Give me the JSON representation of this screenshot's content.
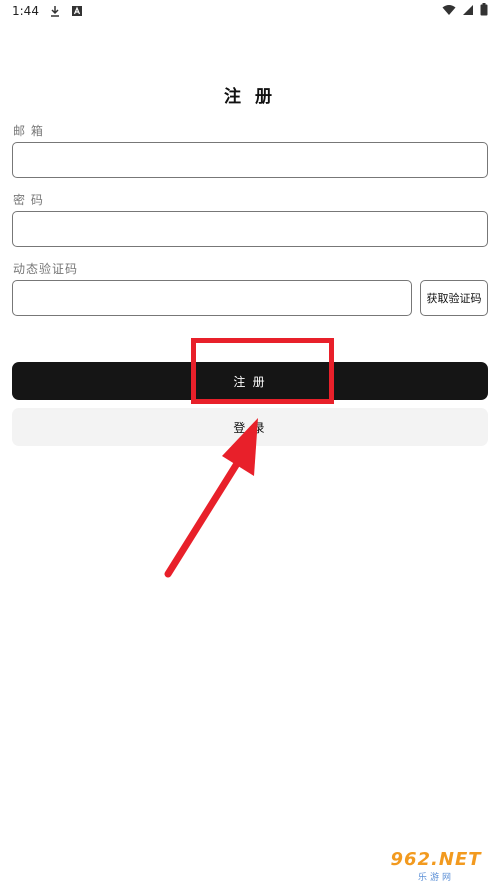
{
  "status_bar": {
    "time": "1:44",
    "icons": [
      "download-icon",
      "a-box-icon",
      "wifi-icon",
      "signal-icon",
      "battery-icon"
    ]
  },
  "form": {
    "title": "注 册",
    "email_label": "邮 箱",
    "email_value": "",
    "password_label": "密 码",
    "password_value": "",
    "code_label": "动态验证码",
    "code_value": "",
    "get_code_label": "获取验证码"
  },
  "actions": {
    "register_label": "注 册",
    "login_label": "登 录"
  },
  "annotation": {
    "color": "#e8202a"
  },
  "watermark": {
    "top": "962.NET",
    "bottom": "乐游网"
  }
}
